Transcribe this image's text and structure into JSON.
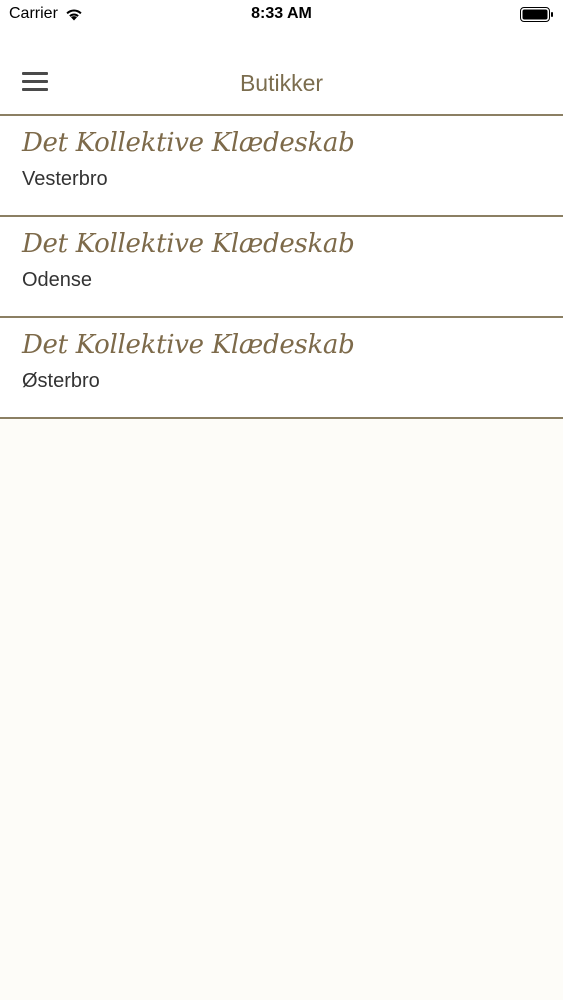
{
  "status_bar": {
    "carrier": "Carrier",
    "time": "8:33 AM",
    "wifi_icon": "wifi-icon",
    "battery_icon": "battery-icon"
  },
  "nav": {
    "title": "Butikker",
    "menu_icon": "hamburger-menu-icon"
  },
  "colors": {
    "accent": "#7b6d4e",
    "divider": "#8b7f63",
    "background": "#fdfcf8",
    "text": "#333333"
  },
  "stores": [
    {
      "brand": "Det Kollektive Klædeskab",
      "location": "Vesterbro"
    },
    {
      "brand": "Det Kollektive Klædeskab",
      "location": "Odense"
    },
    {
      "brand": "Det Kollektive Klædeskab",
      "location": "Østerbro"
    }
  ]
}
